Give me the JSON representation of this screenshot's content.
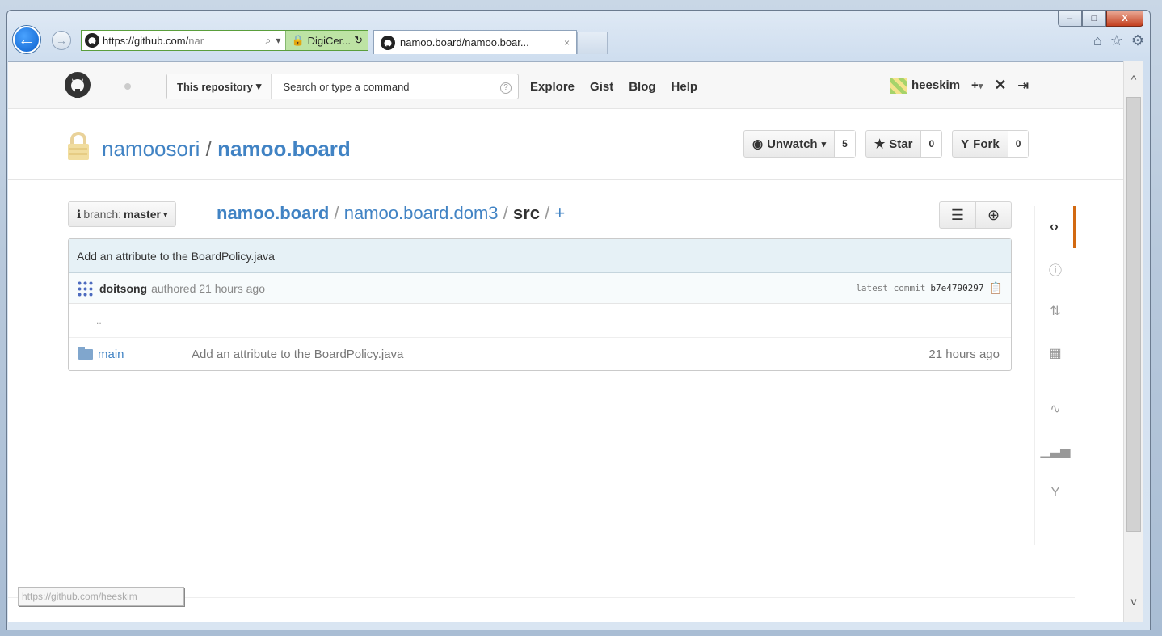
{
  "browser": {
    "address_host": "https://github.com/",
    "address_rest": "nar",
    "cert_label": "DigiCer...",
    "tab_title": "namoo.board/namoo.boar...",
    "tab_close": "×",
    "status_url": "https://github.com/heeskim"
  },
  "window_controls": {
    "minimize": "–",
    "maximize": "□",
    "close": "X"
  },
  "header": {
    "scope_label": "This repository",
    "search_placeholder": "Search or type a command",
    "search_help": "?",
    "nav": [
      "Explore",
      "Gist",
      "Blog",
      "Help"
    ],
    "username": "heeskim",
    "plus_label": "+"
  },
  "repo": {
    "owner": "namoosori",
    "separator": "/",
    "name": "namoo.board",
    "watch_label": "Unwatch",
    "watch_count": "5",
    "star_label": "Star",
    "star_count": "0",
    "fork_label": "Fork",
    "fork_count": "0"
  },
  "browser_path": {
    "branch_prefix": "branch:",
    "branch": "master",
    "crumbs": [
      "namoo.board",
      "namoo.board.dom3"
    ],
    "current": "src",
    "plus": "+"
  },
  "commit": {
    "message": "Add an attribute to the BoardPolicy.java",
    "author": "doitsong",
    "authored": "authored 21 hours ago",
    "latest_label": "latest commit",
    "sha": "b7e4790297"
  },
  "files": {
    "updir": "..",
    "rows": [
      {
        "name": "main",
        "message": "Add an attribute to the BoardPolicy.java",
        "age": "21 hours ago"
      }
    ]
  },
  "colors": {
    "link": "#4183c4",
    "accent": "#d26911",
    "commit_bg": "#e6f1f6"
  }
}
